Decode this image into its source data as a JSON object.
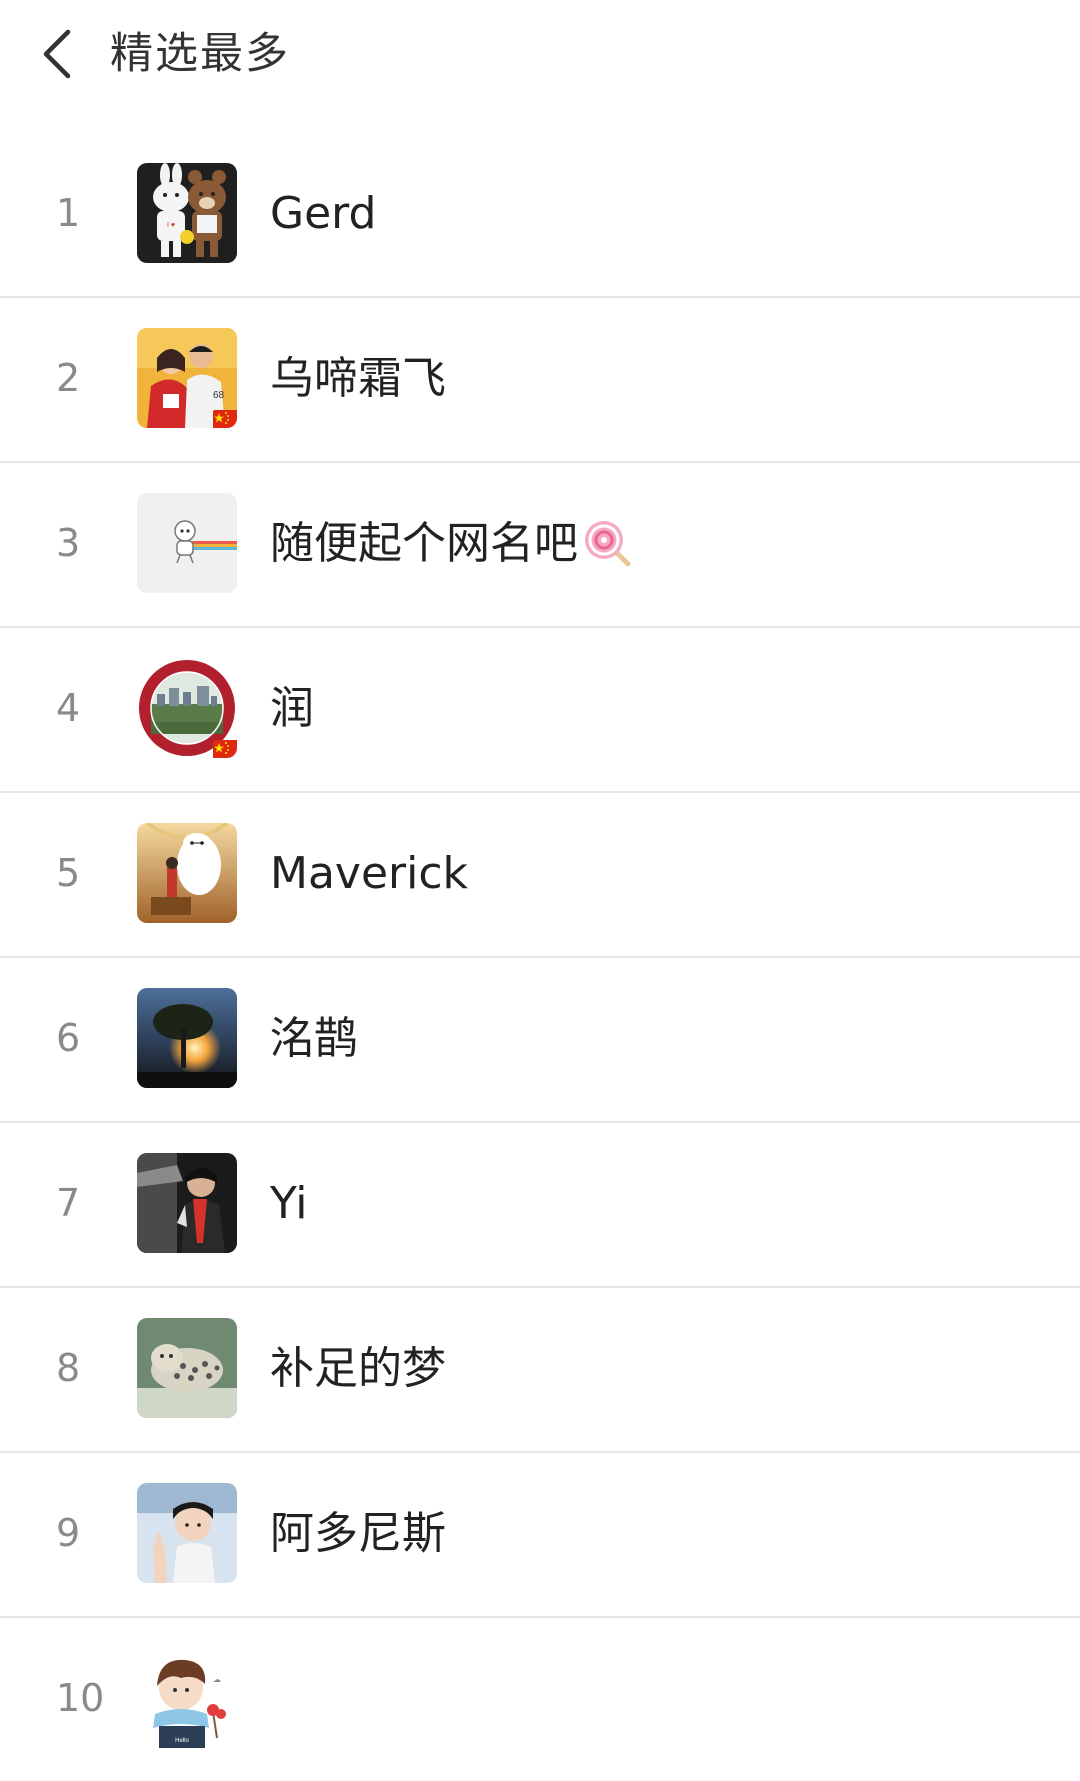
{
  "header": {
    "title": "精选最多",
    "back_icon": "chevron-left-icon"
  },
  "colors": {
    "divider": "#e6e6e6",
    "rank_text": "#8a8a8a",
    "name_text": "#222222"
  },
  "list": {
    "items": [
      {
        "rank": "1",
        "name": "Gerd",
        "avatar": "bear-and-bunny-avatar"
      },
      {
        "rank": "2",
        "name": "乌啼霜飞",
        "avatar": "couple-photo-avatar",
        "badge": "china-flag-icon"
      },
      {
        "rank": "3",
        "name": "随便起个网名吧",
        "avatar": "cartoon-figure-avatar",
        "emoji": "lollipop-icon"
      },
      {
        "rank": "4",
        "name": "润",
        "avatar": "academy-seal-avatar",
        "badge": "china-flag-icon"
      },
      {
        "rank": "5",
        "name": "Maverick",
        "avatar": "white-robot-avatar"
      },
      {
        "rank": "6",
        "name": "洺鹊",
        "avatar": "sunset-tree-avatar"
      },
      {
        "rank": "7",
        "name": "Yi",
        "avatar": "person-red-scarf-avatar"
      },
      {
        "rank": "8",
        "name": "补足的梦",
        "avatar": "snow-leopard-avatar"
      },
      {
        "rank": "9",
        "name": "阿多尼斯",
        "avatar": "skater-portrait-avatar"
      },
      {
        "rank": "10",
        "name": "",
        "avatar": "cartoon-boy-avatar"
      }
    ]
  }
}
